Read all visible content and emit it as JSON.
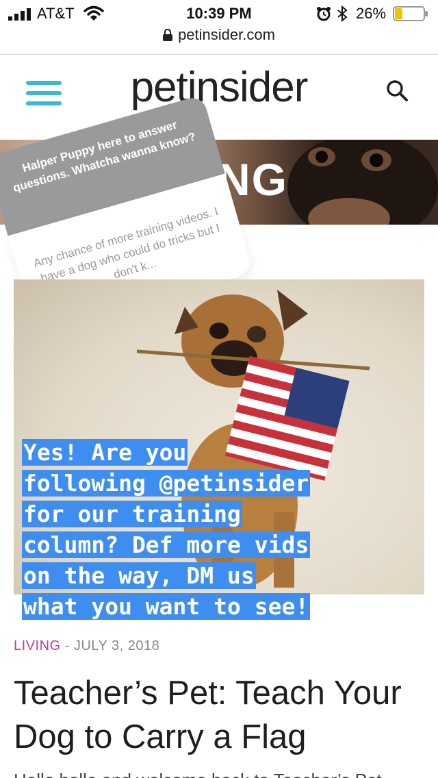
{
  "status_bar": {
    "carrier": "AT&T",
    "time": "10:39 PM",
    "battery_percent": "26%",
    "battery_level": 0.26,
    "battery_color": "#f2c100",
    "icons": [
      "signal-icon",
      "wifi-icon",
      "alarm-icon",
      "bluetooth-icon",
      "battery-icon"
    ]
  },
  "browser": {
    "url": "petinsider.com",
    "icons": [
      "lock-icon"
    ]
  },
  "site_header": {
    "logo_part1": "pet",
    "logo_part2": "insider",
    "icons": [
      "menu-icon",
      "search-icon"
    ],
    "menu_icon_color": "#3bb8d4"
  },
  "hero": {
    "visible_text": "NG"
  },
  "story": {
    "question_prompt": "Halper Puppy here to answer questions. Whatcha wanna know?",
    "question_text": "Any chance of more training videos. I have a dog who could do tricks but I don't k...",
    "answer_lines": [
      "Yes! Are you",
      "following @petinsider",
      "for our training",
      "column? Def more vids",
      "on the way, DM us",
      "what you want to see!"
    ],
    "answer_highlight_color": "#3d8ef0"
  },
  "article": {
    "category": "LIVING",
    "separator": " - ",
    "date": "JULY 3, 2018",
    "category_color": "#c23c9e",
    "headline": "Teacher’s Pet: Teach Your Dog to Carry a Flag",
    "teaser": "Hello hello and welcome back to Teacher’s Pet"
  }
}
